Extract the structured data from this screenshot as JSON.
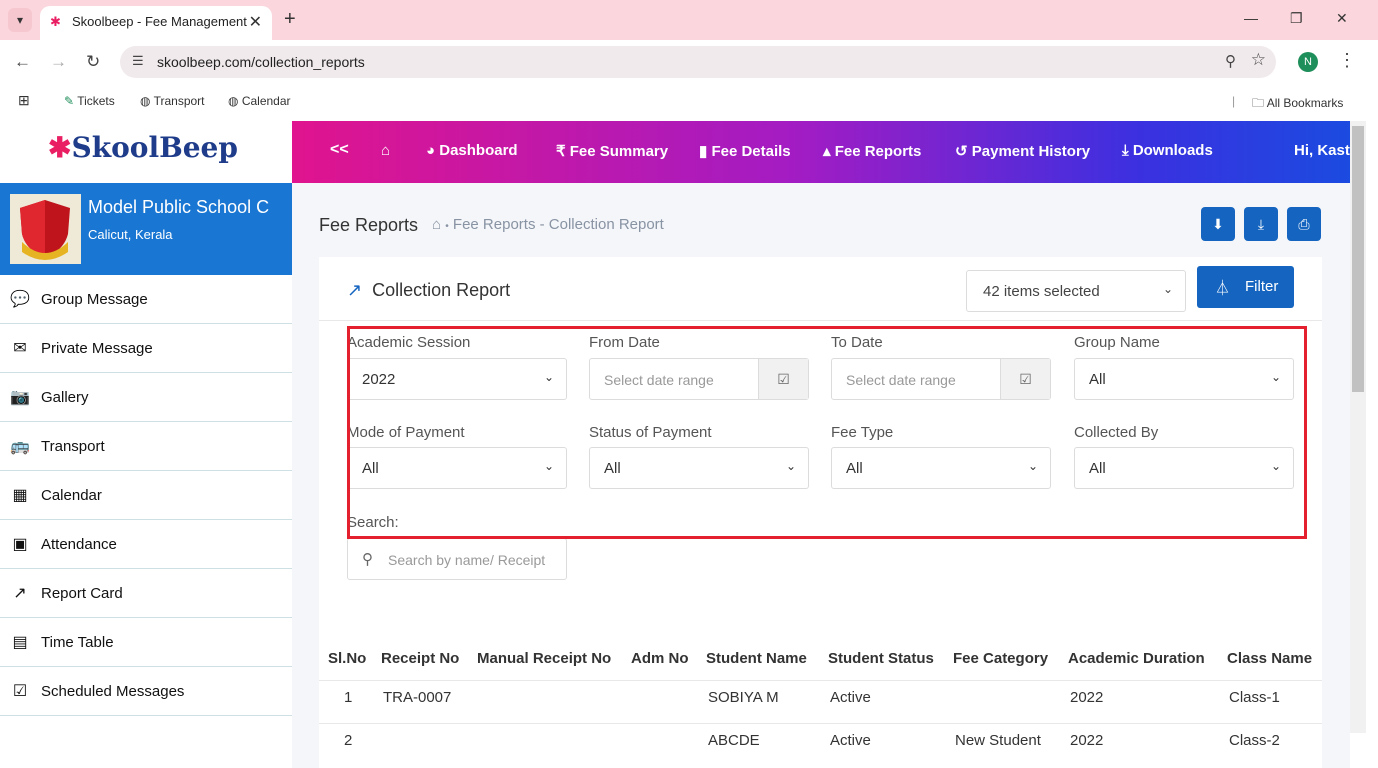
{
  "browser": {
    "tab_title": "Skoolbeep - Fee Management",
    "url": "skoolbeep.com/collection_reports",
    "profile_initial": "N",
    "bookmarks": [
      "Tickets",
      "Transport",
      "Calendar"
    ],
    "all_bookmarks": "All Bookmarks"
  },
  "app": {
    "logo": "SkoolBeep",
    "school_name": "Model Public School C",
    "school_location": "Calicut, Kerala",
    "greeting": "Hi,  Kast"
  },
  "sidebar": {
    "items": [
      {
        "label": "Group Message",
        "icon": "group-message-icon"
      },
      {
        "label": "Private Message",
        "icon": "envelope-icon"
      },
      {
        "label": "Gallery",
        "icon": "camera-icon"
      },
      {
        "label": "Transport",
        "icon": "bus-icon"
      },
      {
        "label": "Calendar",
        "icon": "calendar-icon"
      },
      {
        "label": "Attendance",
        "icon": "calendar-check-icon"
      },
      {
        "label": "Report Card",
        "icon": "chart-line-icon"
      },
      {
        "label": "Time Table",
        "icon": "timetable-icon"
      },
      {
        "label": "Scheduled Messages",
        "icon": "calendar-check-icon"
      }
    ]
  },
  "topnav": {
    "collapse": "<<",
    "dashboard": "Dashboard",
    "fee_summary": "Fee Summary",
    "fee_details": "Fee Details",
    "fee_reports": "Fee Reports",
    "payment_history": "Payment History",
    "downloads": "Downloads"
  },
  "page": {
    "title": "Fee Reports",
    "breadcrumb": "Fee Reports - Collection Report"
  },
  "card": {
    "title": "Collection Report",
    "multiselect": "42 items selected",
    "filter_button": "Filter"
  },
  "filters": {
    "academic_session": {
      "label": "Academic Session",
      "value": "2022"
    },
    "from_date": {
      "label": "From Date",
      "placeholder": "Select date range"
    },
    "to_date": {
      "label": "To Date",
      "placeholder": "Select date range"
    },
    "group_name": {
      "label": "Group Name",
      "value": "All"
    },
    "mode_of_payment": {
      "label": "Mode of Payment",
      "value": "All"
    },
    "status_of_payment": {
      "label": "Status of Payment",
      "value": "All"
    },
    "fee_type": {
      "label": "Fee Type",
      "value": "All"
    },
    "collected_by": {
      "label": "Collected By",
      "value": "All"
    },
    "search": {
      "label": "Search:",
      "placeholder": "Search by name/ Receipt"
    }
  },
  "table": {
    "headers": [
      "Sl.No",
      "Receipt No",
      "Manual Receipt No",
      "Adm No",
      "Student Name",
      "Student Status",
      "Fee Category",
      "Academic Duration",
      "Class Name"
    ],
    "rows": [
      [
        "1",
        "TRA-0007",
        "",
        "",
        "SOBIYA M",
        "Active",
        "",
        "2022",
        "Class-1"
      ],
      [
        "2",
        "",
        "",
        "",
        "ABCDE",
        "Active",
        "New Student",
        "2022",
        "Class-2"
      ]
    ]
  }
}
